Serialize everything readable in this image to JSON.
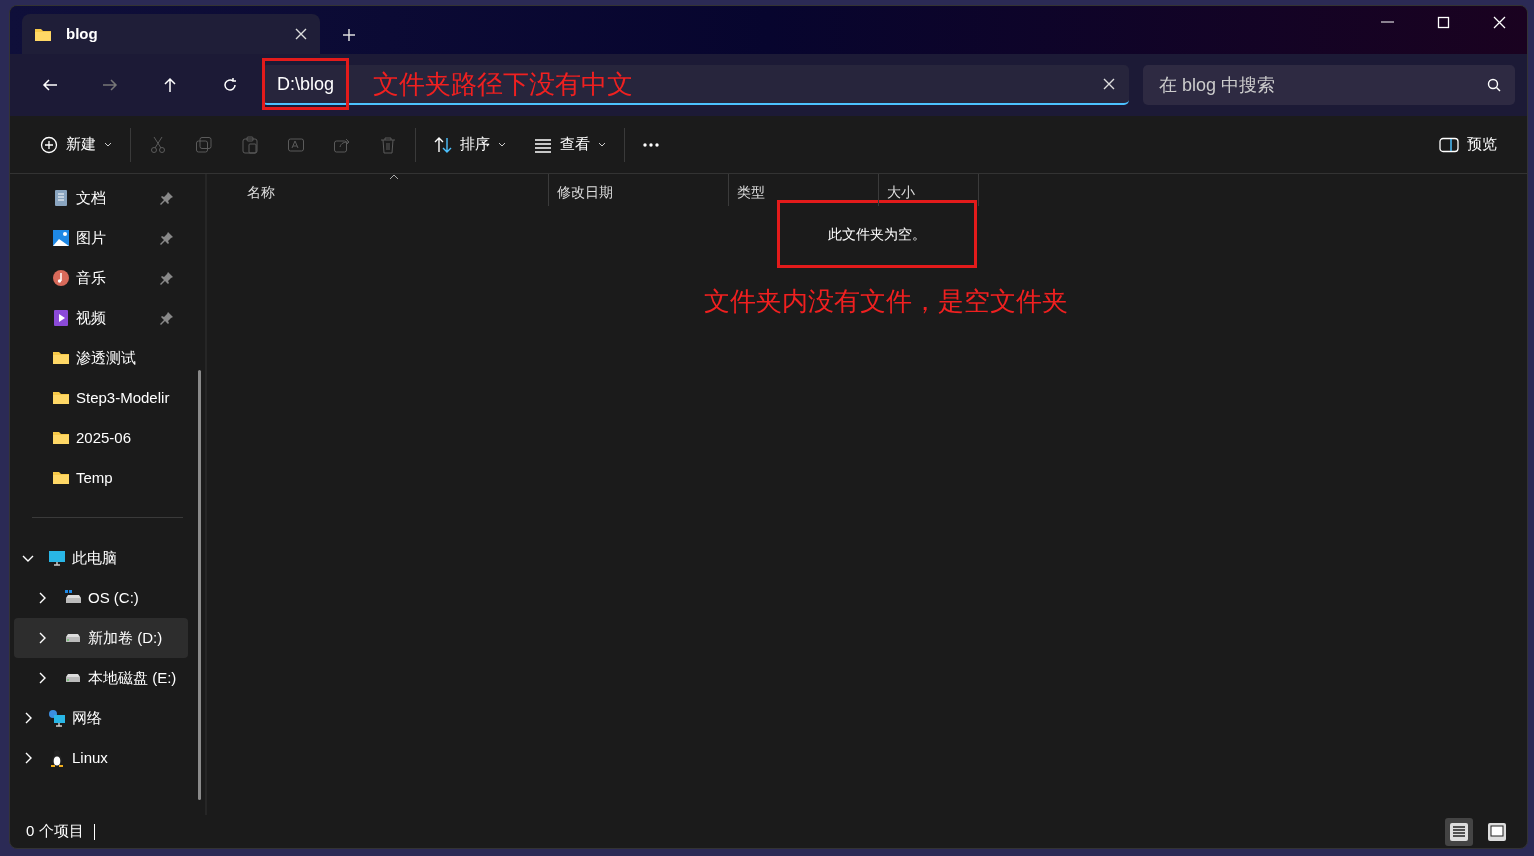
{
  "tab": {
    "title": "blog",
    "selected": true
  },
  "address": {
    "value": "D:\\blog",
    "note": "文件夹路径下没有中文"
  },
  "search": {
    "placeholder": "在 blog 中搜索"
  },
  "toolbar": [
    {
      "kind": "new",
      "label": "新建"
    },
    {
      "kind": "cut",
      "disabled": true
    },
    {
      "kind": "copy",
      "disabled": true
    },
    {
      "kind": "paste",
      "disabled": true
    },
    {
      "kind": "rename",
      "disabled": true
    },
    {
      "kind": "share",
      "disabled": true
    },
    {
      "kind": "delete",
      "disabled": true
    },
    {
      "kind": "sort",
      "label": "排序"
    },
    {
      "kind": "view",
      "label": "查看"
    },
    {
      "kind": "more"
    }
  ],
  "preview_label": "预览",
  "quick_access": [
    {
      "kind": "documents",
      "label": "文档",
      "pinned": true
    },
    {
      "kind": "pictures",
      "label": "图片",
      "pinned": true
    },
    {
      "kind": "music",
      "label": "音乐",
      "pinned": true
    },
    {
      "kind": "videos",
      "label": "视频",
      "pinned": true
    },
    {
      "kind": "folder",
      "label": "渗透测试",
      "pinned": false
    },
    {
      "kind": "folder",
      "label": "Step3-Modelir",
      "pinned": false
    },
    {
      "kind": "folder",
      "label": "2025-06",
      "pinned": false
    },
    {
      "kind": "folder",
      "label": "Temp",
      "pinned": false
    }
  ],
  "tree": [
    {
      "kind": "pc",
      "label": "此电脑",
      "expanded": true,
      "selected": false,
      "children": [
        {
          "kind": "osdrive",
          "label": "OS (C:)",
          "expanded": false,
          "selected": false
        },
        {
          "kind": "drive",
          "label": "新加卷 (D:)",
          "expanded": false,
          "selected": true
        },
        {
          "kind": "drive",
          "label": "本地磁盘 (E:)",
          "expanded": false,
          "selected": false
        }
      ]
    },
    {
      "kind": "network",
      "label": "网络",
      "expanded": false,
      "selected": false
    },
    {
      "kind": "linux",
      "label": "Linux",
      "expanded": false,
      "selected": false
    }
  ],
  "columns": [
    {
      "label": "名称",
      "sorted": true
    },
    {
      "label": "修改日期"
    },
    {
      "label": "类型"
    },
    {
      "label": "大小"
    }
  ],
  "empty_message": "此文件夹为空。",
  "empty_note": "文件夹内没有文件，是空文件夹",
  "status": "0 个项目",
  "view_modes": [
    {
      "kind": "details",
      "selected": true
    },
    {
      "kind": "tiles",
      "selected": false
    }
  ]
}
